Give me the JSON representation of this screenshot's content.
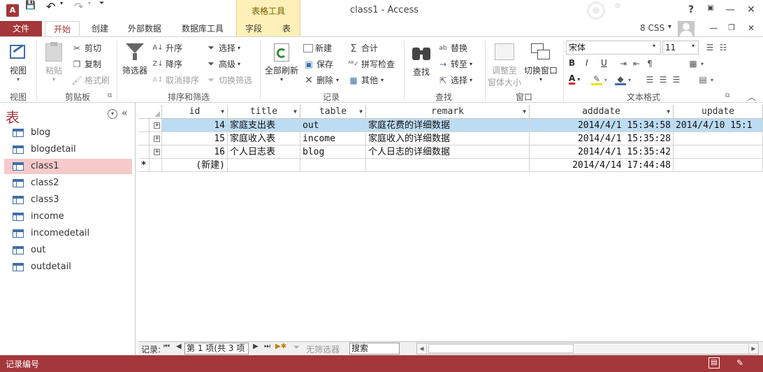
{
  "window": {
    "title": "class1 - Access",
    "context_group": "表格工具",
    "help": "?",
    "minimize": "—",
    "maximize": "☐",
    "close": "✕"
  },
  "quick_access": {
    "save": "💾",
    "undo": "↶",
    "redo": "↷",
    "customize": "⏷"
  },
  "tabs": {
    "file": "文件",
    "items": [
      "开始",
      "创建",
      "外部数据",
      "数据库工具",
      "字段",
      "表"
    ]
  },
  "user": {
    "name": "8 CSS",
    "caret": "▾"
  },
  "ribbon": {
    "groups": {
      "view": "视图",
      "clipboard": "剪贴板",
      "sort_filter": "排序和筛选",
      "records": "记录",
      "find": "查找",
      "window": "窗口",
      "text_format": "文本格式"
    },
    "view_btn": "视图",
    "paste_btn": "粘贴",
    "cut": "剪切",
    "copy": "复制",
    "format_painter": "格式刷",
    "filter_btn": "筛选器",
    "ascending": "升序",
    "descending": "降序",
    "remove_sort": "取消排序",
    "selection": "选择",
    "advanced": "高级",
    "toggle_filter": "切换筛选",
    "refresh_all": "全部刷新",
    "new": "新建",
    "save": "保存",
    "delete": "删除",
    "totals": "合计",
    "spelling": "拼写检查",
    "more": "其他",
    "find_btn": "查找",
    "replace": "替换",
    "goto": "转至",
    "select": "选择",
    "size_to_fit_1": "调整至",
    "size_to_fit_2": "窗体大小",
    "switch_windows": "切换窗口",
    "font_name": "宋体",
    "font_size": "11",
    "bold": "B",
    "italic": "I",
    "underline": "U",
    "font_color": "A"
  },
  "nav": {
    "title": "表",
    "items": [
      "blog",
      "blogdetail",
      "class1",
      "class2",
      "class3",
      "income",
      "incomedetail",
      "out",
      "outdetail"
    ],
    "selected_index": 2
  },
  "table": {
    "columns": [
      "id",
      "title",
      "table",
      "remark",
      "adddate",
      "update"
    ],
    "rows": [
      {
        "id": "14",
        "title": "家庭支出表",
        "table": "out",
        "remark": "家庭花费的详细数据",
        "adddate": "2014/4/1 15:34:58",
        "update": "2014/4/10 15:1"
      },
      {
        "id": "15",
        "title": "家庭收入表",
        "table": "income",
        "remark": "家庭收入的详细数据",
        "adddate": "2014/4/1 15:35:28",
        "update": ""
      },
      {
        "id": "16",
        "title": "个人日志表",
        "table": "blog",
        "remark": "个人日志的详细数据",
        "adddate": "2014/4/1 15:35:42",
        "update": ""
      }
    ],
    "new_row": {
      "marker": "*",
      "id": "(新建)",
      "adddate": "2014/4/14 17:44:48"
    }
  },
  "recordbar": {
    "label": "记录:",
    "position": "第 1 项(共 3 项",
    "no_filter": "无筛选器",
    "search": "搜索"
  },
  "status": {
    "text": "记录编号"
  }
}
